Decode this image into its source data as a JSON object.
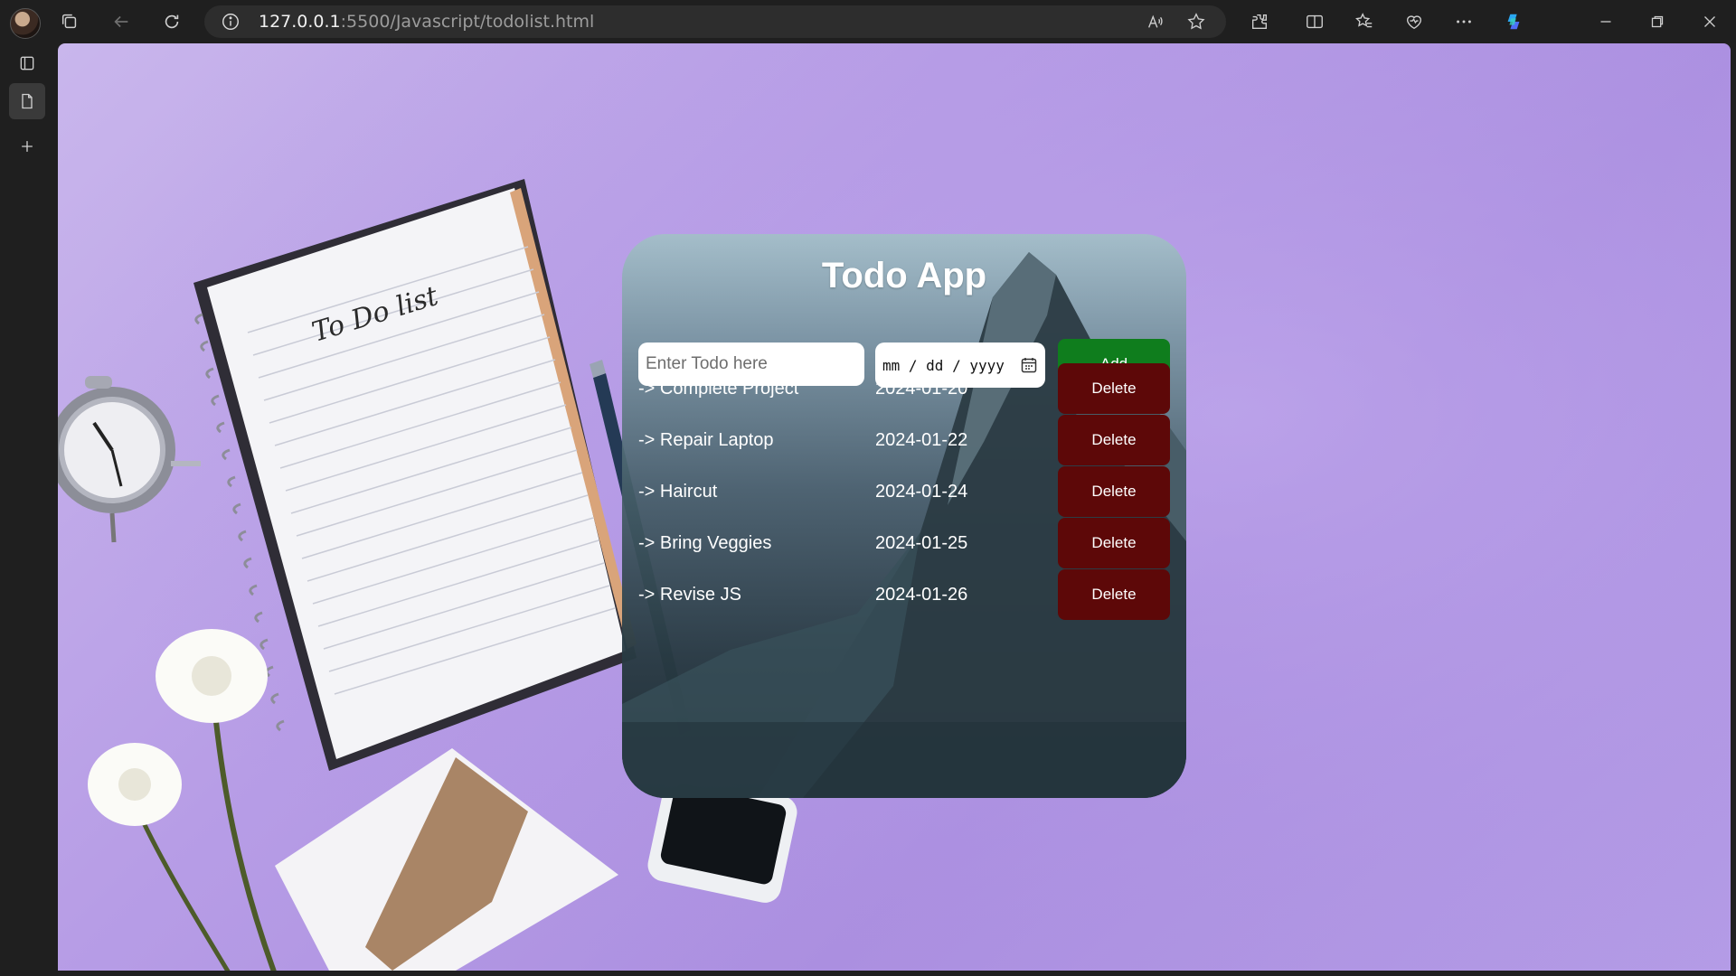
{
  "browser": {
    "url_host": "127.0.0.1",
    "url_path": ":5500/Javascript/todolist.html"
  },
  "app": {
    "title": "Todo App",
    "input_placeholder": "Enter Todo here",
    "date_placeholder": "mm / dd / yyyy",
    "add_label": "Add",
    "todos": [
      {
        "name": "-> Complete Project",
        "date": "2024-01-20",
        "delete_label": "Delete"
      },
      {
        "name": "-> Repair Laptop",
        "date": "2024-01-22",
        "delete_label": "Delete"
      },
      {
        "name": "-> Haircut",
        "date": "2024-01-24",
        "delete_label": "Delete"
      },
      {
        "name": "-> Bring Veggies",
        "date": "2024-01-25",
        "delete_label": "Delete"
      },
      {
        "name": "-> Revise JS",
        "date": "2024-01-26",
        "delete_label": "Delete"
      }
    ]
  },
  "background": {
    "notebook_text": "To Do list"
  },
  "colors": {
    "add_button": "#0f7d1d",
    "delete_button": "#5d0808",
    "background": "#b79de6"
  }
}
